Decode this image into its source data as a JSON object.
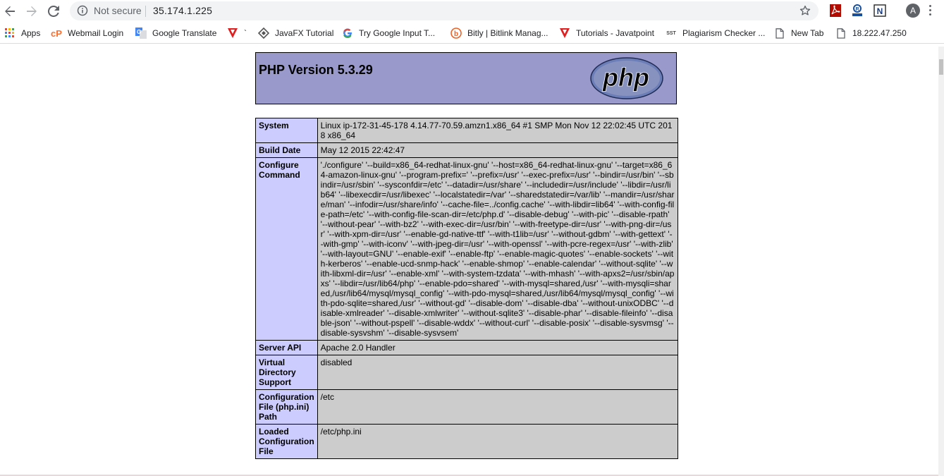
{
  "browser": {
    "security_label": "Not secure",
    "url": "35.174.1.225",
    "profile_initial": "A",
    "bookmarks": [
      {
        "label": "Apps",
        "icon": "apps-grid-icon"
      },
      {
        "label": "Webmail Login",
        "icon": "cpanel-icon"
      },
      {
        "label": "Google Translate",
        "icon": "translate-icon"
      },
      {
        "label": "`",
        "icon": "v-logo-icon"
      },
      {
        "label": "JavaFX Tutorial",
        "icon": "diamond-icon"
      },
      {
        "label": "Try Google Input T...",
        "icon": "google-g-icon"
      },
      {
        "label": "Bitly | Bitlink Manag...",
        "icon": "bitly-icon"
      },
      {
        "label": "Tutorials - Javatpoint",
        "icon": "v-logo-icon"
      },
      {
        "label": "Plagiarism Checker ...",
        "icon": "sst-icon"
      },
      {
        "label": "New Tab",
        "icon": "page-icon"
      },
      {
        "label": "18.222.47.250",
        "icon": "page-icon"
      }
    ],
    "sst_text": "SST"
  },
  "php": {
    "title": "PHP Version 5.3.29",
    "logo_text": "php",
    "rows": [
      {
        "key": "System",
        "value": "Linux ip-172-31-45-178 4.14.77-70.59.amzn1.x86_64 #1 SMP Mon Nov 12 22:02:45 UTC 2018 x86_64"
      },
      {
        "key": "Build Date",
        "value": "May 12 2015 22:42:47"
      },
      {
        "key": "Configure Command",
        "value": "'./configure' '--build=x86_64-redhat-linux-gnu' '--host=x86_64-redhat-linux-gnu' '--target=x86_64-amazon-linux-gnu' '--program-prefix=' '--prefix=/usr' '--exec-prefix=/usr' '--bindir=/usr/bin' '--sbindir=/usr/sbin' '--sysconfdir=/etc' '--datadir=/usr/share' '--includedir=/usr/include' '--libdir=/usr/lib64' '--libexecdir=/usr/libexec' '--localstatedir=/var' '--sharedstatedir=/var/lib' '--mandir=/usr/share/man' '--infodir=/usr/share/info' '--cache-file=../config.cache' '--with-libdir=lib64' '--with-config-file-path=/etc' '--with-config-file-scan-dir=/etc/php.d' '--disable-debug' '--with-pic' '--disable-rpath' '--without-pear' '--with-bz2' '--with-exec-dir=/usr/bin' '--with-freetype-dir=/usr' '--with-png-dir=/usr' '--with-xpm-dir=/usr' '--enable-gd-native-ttf' '--with-t1lib=/usr' '--without-gdbm' '--with-gettext' '--with-gmp' '--with-iconv' '--with-jpeg-dir=/usr' '--with-openssl' '--with-pcre-regex=/usr' '--with-zlib' '--with-layout=GNU' '--enable-exif' '--enable-ftp' '--enable-magic-quotes' '--enable-sockets' '--with-kerberos' '--enable-ucd-snmp-hack' '--enable-shmop' '--enable-calendar' '--without-sqlite' '--with-libxml-dir=/usr' '--enable-xml' '--with-system-tzdata' '--with-mhash' '--with-apxs2=/usr/sbin/apxs' '--libdir=/usr/lib64/php' '--enable-pdo=shared' '--with-mysql=shared,/usr' '--with-mysqli=shared,/usr/lib64/mysql/mysql_config' '--with-pdo-mysql=shared,/usr/lib64/mysql/mysql_config' '--with-pdo-sqlite=shared,/usr' '--without-gd' '--disable-dom' '--disable-dba' '--without-unixODBC' '--disable-xmlreader' '--disable-xmlwriter' '--without-sqlite3' '--disable-phar' '--disable-fileinfo' '--disable-json' '--without-pspell' '--disable-wddx' '--without-curl' '--disable-posix' '--disable-sysvmsg' '--disable-sysvshm' '--disable-sysvsem'"
      },
      {
        "key": "Server API",
        "value": "Apache 2.0 Handler"
      },
      {
        "key": "Virtual Directory Support",
        "value": "disabled"
      },
      {
        "key": "Configuration File (php.ini) Path",
        "value": "/etc"
      },
      {
        "key": "Loaded Configuration File",
        "value": "/etc/php.ini"
      }
    ]
  },
  "colors": {
    "header_bg": "#9999cc",
    "key_bg": "#ccccff",
    "value_bg": "#cccccc"
  }
}
